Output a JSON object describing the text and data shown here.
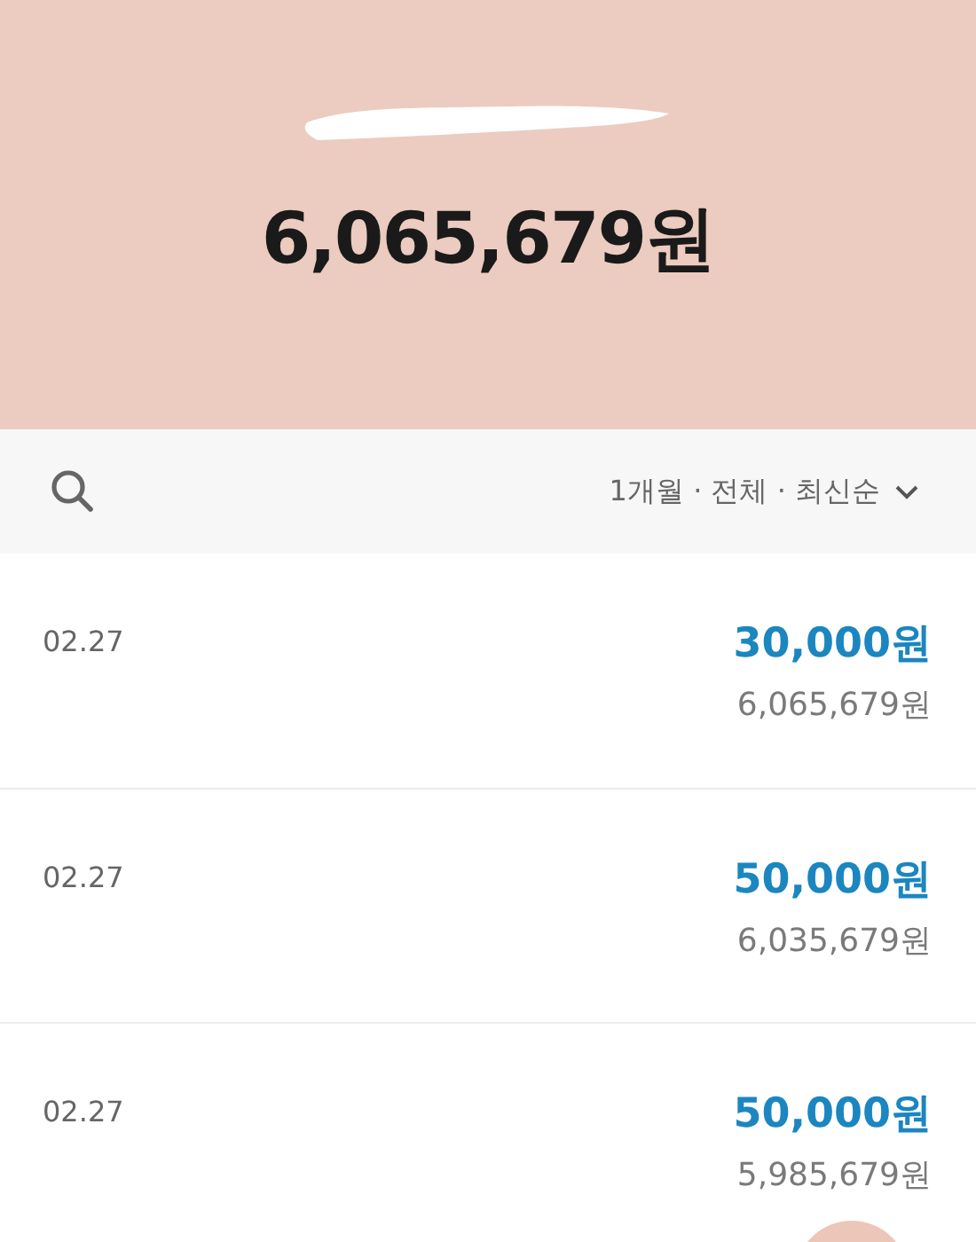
{
  "header": {
    "balance": "6,065,679원"
  },
  "filter_bar": {
    "filter": "1개월 · 전체 · 최신순"
  },
  "transactions": [
    {
      "date": "02.27",
      "amount": "30,000원",
      "balance": "6,065,679원"
    },
    {
      "date": "02.27",
      "amount": "50,000원",
      "balance": "6,035,679원"
    },
    {
      "date": "02.27",
      "amount": "50,000원",
      "balance": "5,985,679원"
    }
  ]
}
